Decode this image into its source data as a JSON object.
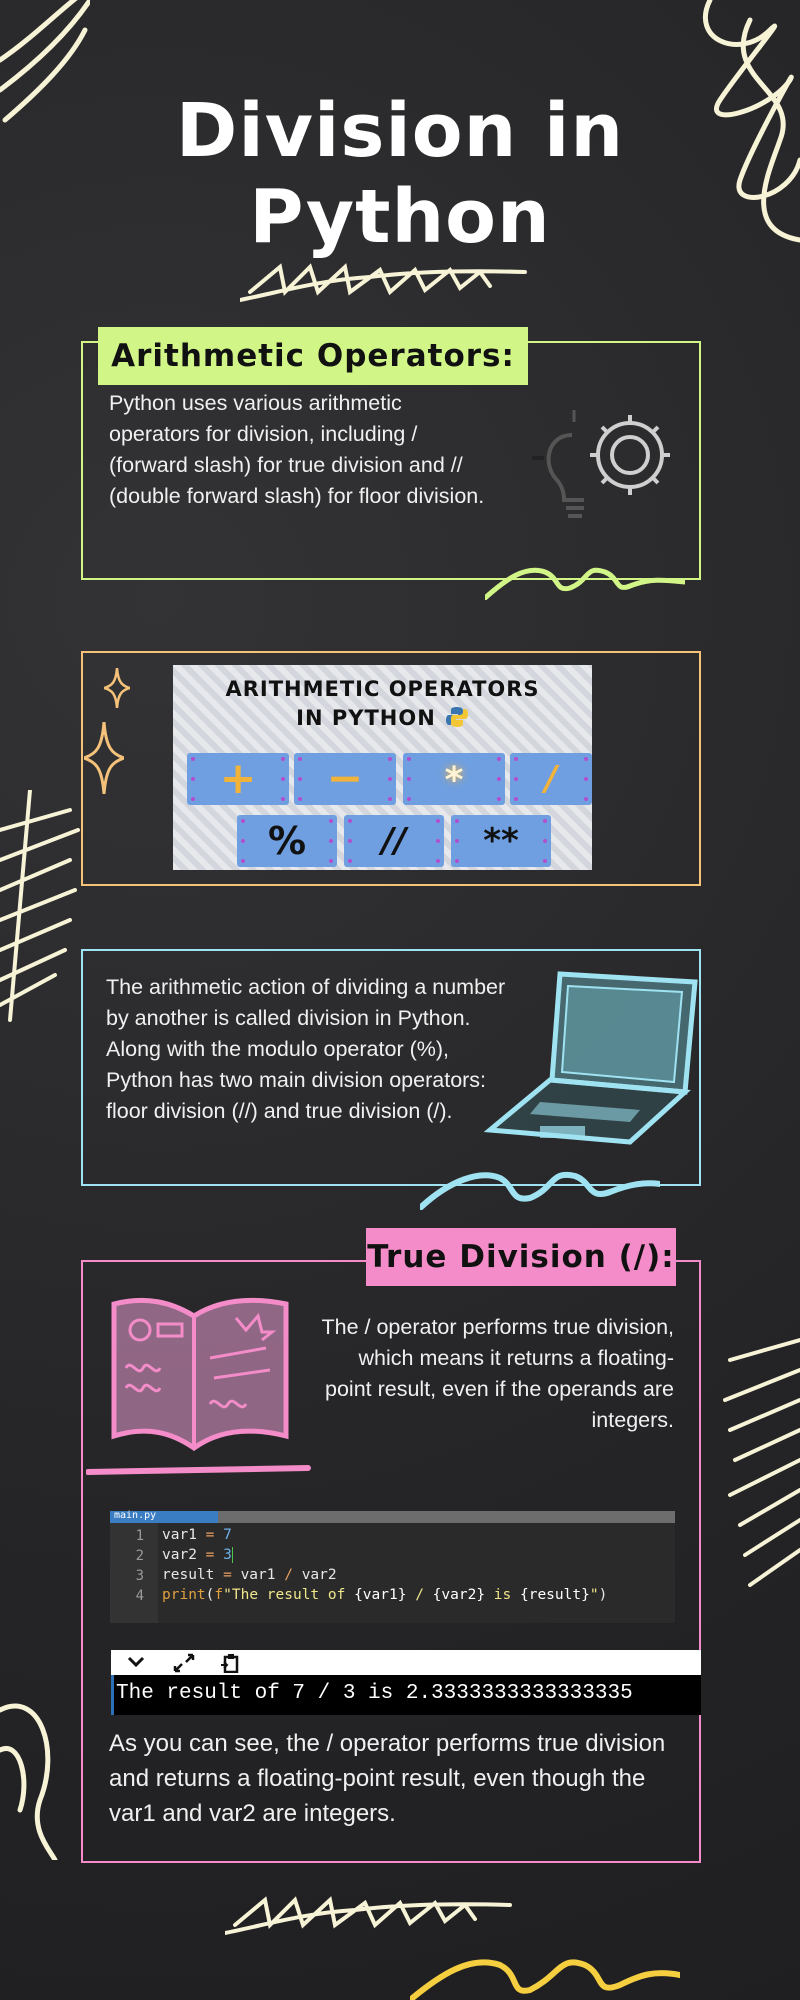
{
  "header": {
    "title_line1": "Division in",
    "title_line2": "Python"
  },
  "section_arith": {
    "tag": "Arithmetic Operators:",
    "text": "Python uses various arithmetic operators for division, including / (forward slash) for true division and // (double forward slash) for floor division.",
    "icon": "lightbulb-gear-icon"
  },
  "operators_image": {
    "heading_line1": "ARITHMETIC OPERATORS",
    "heading_line2": "IN PYTHON",
    "python_logo": "python-logo-icon",
    "row1": [
      "+",
      "−",
      "*",
      "/"
    ],
    "row2": [
      "%",
      "//",
      "**"
    ]
  },
  "section_intro": {
    "text": "The arithmetic action of dividing a number by another is called division in Python. Along with the modulo operator (%), Python has two main division operators: floor division (//) and true division (/).",
    "icon": "laptop-icon"
  },
  "section_true": {
    "tag": "True Division (/):",
    "text": "The / operator performs true division, which means it returns a floating-point result, even if the operands are integers.",
    "icon": "open-book-icon",
    "code_tab": "main.py",
    "line_numbers": [
      "1",
      "2",
      "3",
      "4"
    ],
    "terminal_output": "The result of 7 / 3 is 2.3333333333333335",
    "conclusion": "As you can see, the / operator performs true division and returns a floating-point result, even though the var1 and var2 are integers."
  },
  "colors": {
    "green": "#d2f587",
    "orange": "#f5c27a",
    "cyan": "#9fe3f2",
    "pink": "#f38cc8",
    "yellow": "#f5cf3f",
    "cream": "#f7f3d6"
  }
}
